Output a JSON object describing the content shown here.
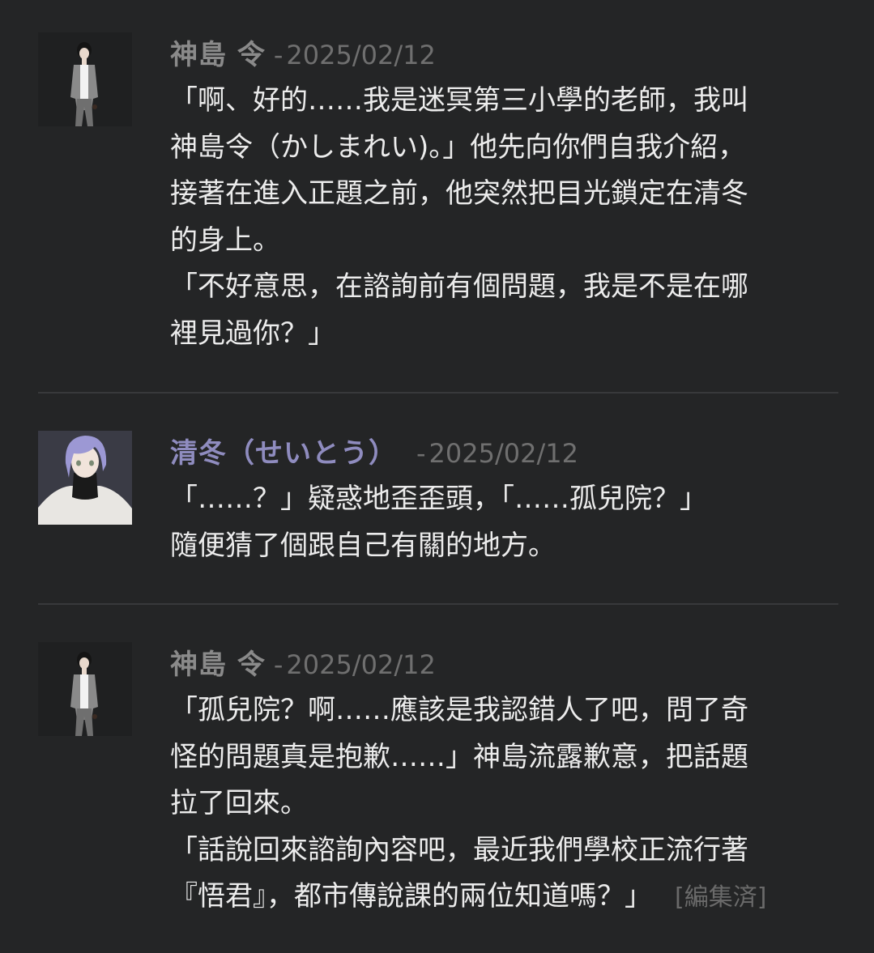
{
  "posts": [
    {
      "author": "神島 令",
      "separator": "-",
      "date": "2025/02/12",
      "lines": [
        "「啊、好的……我是迷冥第三小學的老師，我叫",
        "神島令（かしまれい)。」他先向你們自我介紹，",
        "接著在進入正題之前，他突然把目光鎖定在清冬",
        "的身上。",
        "「不好意思，在諮詢前有個問題，我是不是在哪",
        "裡見過你？」"
      ]
    },
    {
      "author": "清冬（せいとう）",
      "separator": "-",
      "date": "2025/02/12",
      "lines": [
        "「……？」疑惑地歪歪頭，「……孤兒院？」",
        "隨便猜了個跟自己有關的地方。"
      ]
    },
    {
      "author": "神島 令",
      "separator": "-",
      "date": "2025/02/12",
      "lines": [
        "「孤兒院？啊……應該是我認錯人了吧，問了奇",
        "怪的問題真是抱歉……」神島流露歉意，把話題",
        "拉了回來。",
        "「話說回來諮詢內容吧，最近我們學校正流行著",
        "『悟君』，都市傳說課的兩位知道嗎？」"
      ],
      "edited_tag": "[編集済]"
    }
  ],
  "colors": {
    "background": "#242526",
    "author_kashima": "#8a8a8a",
    "author_seito": "#8f8cbf",
    "date": "#6f6f6f",
    "text": "#ececec",
    "divider": "#38393b"
  }
}
